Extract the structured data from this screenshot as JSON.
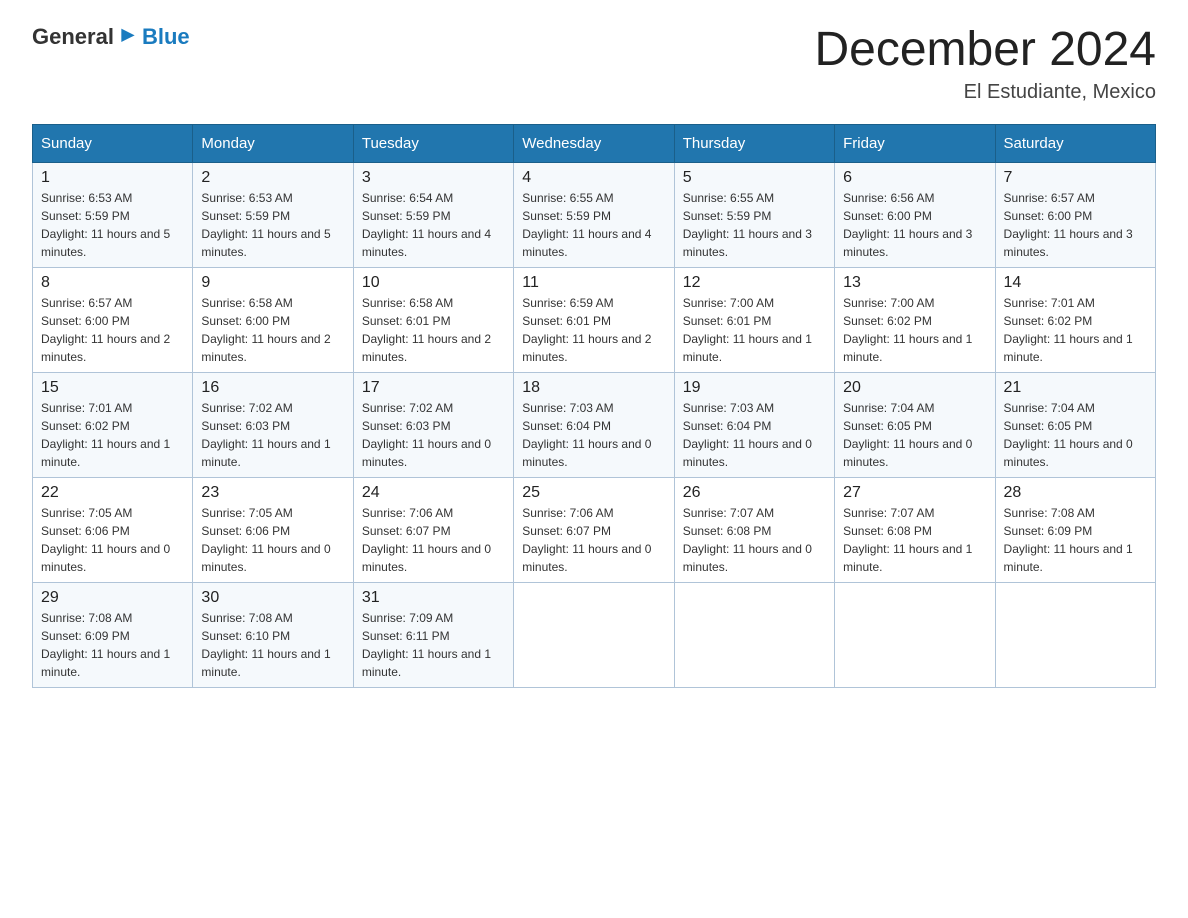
{
  "header": {
    "logo_general": "General",
    "logo_blue": "Blue",
    "month_title": "December 2024",
    "location": "El Estudiante, Mexico"
  },
  "weekdays": [
    "Sunday",
    "Monday",
    "Tuesday",
    "Wednesday",
    "Thursday",
    "Friday",
    "Saturday"
  ],
  "weeks": [
    [
      {
        "day": "1",
        "sunrise": "6:53 AM",
        "sunset": "5:59 PM",
        "daylight": "11 hours and 5 minutes."
      },
      {
        "day": "2",
        "sunrise": "6:53 AM",
        "sunset": "5:59 PM",
        "daylight": "11 hours and 5 minutes."
      },
      {
        "day": "3",
        "sunrise": "6:54 AM",
        "sunset": "5:59 PM",
        "daylight": "11 hours and 4 minutes."
      },
      {
        "day": "4",
        "sunrise": "6:55 AM",
        "sunset": "5:59 PM",
        "daylight": "11 hours and 4 minutes."
      },
      {
        "day": "5",
        "sunrise": "6:55 AM",
        "sunset": "5:59 PM",
        "daylight": "11 hours and 3 minutes."
      },
      {
        "day": "6",
        "sunrise": "6:56 AM",
        "sunset": "6:00 PM",
        "daylight": "11 hours and 3 minutes."
      },
      {
        "day": "7",
        "sunrise": "6:57 AM",
        "sunset": "6:00 PM",
        "daylight": "11 hours and 3 minutes."
      }
    ],
    [
      {
        "day": "8",
        "sunrise": "6:57 AM",
        "sunset": "6:00 PM",
        "daylight": "11 hours and 2 minutes."
      },
      {
        "day": "9",
        "sunrise": "6:58 AM",
        "sunset": "6:00 PM",
        "daylight": "11 hours and 2 minutes."
      },
      {
        "day": "10",
        "sunrise": "6:58 AM",
        "sunset": "6:01 PM",
        "daylight": "11 hours and 2 minutes."
      },
      {
        "day": "11",
        "sunrise": "6:59 AM",
        "sunset": "6:01 PM",
        "daylight": "11 hours and 2 minutes."
      },
      {
        "day": "12",
        "sunrise": "7:00 AM",
        "sunset": "6:01 PM",
        "daylight": "11 hours and 1 minute."
      },
      {
        "day": "13",
        "sunrise": "7:00 AM",
        "sunset": "6:02 PM",
        "daylight": "11 hours and 1 minute."
      },
      {
        "day": "14",
        "sunrise": "7:01 AM",
        "sunset": "6:02 PM",
        "daylight": "11 hours and 1 minute."
      }
    ],
    [
      {
        "day": "15",
        "sunrise": "7:01 AM",
        "sunset": "6:02 PM",
        "daylight": "11 hours and 1 minute."
      },
      {
        "day": "16",
        "sunrise": "7:02 AM",
        "sunset": "6:03 PM",
        "daylight": "11 hours and 1 minute."
      },
      {
        "day": "17",
        "sunrise": "7:02 AM",
        "sunset": "6:03 PM",
        "daylight": "11 hours and 0 minutes."
      },
      {
        "day": "18",
        "sunrise": "7:03 AM",
        "sunset": "6:04 PM",
        "daylight": "11 hours and 0 minutes."
      },
      {
        "day": "19",
        "sunrise": "7:03 AM",
        "sunset": "6:04 PM",
        "daylight": "11 hours and 0 minutes."
      },
      {
        "day": "20",
        "sunrise": "7:04 AM",
        "sunset": "6:05 PM",
        "daylight": "11 hours and 0 minutes."
      },
      {
        "day": "21",
        "sunrise": "7:04 AM",
        "sunset": "6:05 PM",
        "daylight": "11 hours and 0 minutes."
      }
    ],
    [
      {
        "day": "22",
        "sunrise": "7:05 AM",
        "sunset": "6:06 PM",
        "daylight": "11 hours and 0 minutes."
      },
      {
        "day": "23",
        "sunrise": "7:05 AM",
        "sunset": "6:06 PM",
        "daylight": "11 hours and 0 minutes."
      },
      {
        "day": "24",
        "sunrise": "7:06 AM",
        "sunset": "6:07 PM",
        "daylight": "11 hours and 0 minutes."
      },
      {
        "day": "25",
        "sunrise": "7:06 AM",
        "sunset": "6:07 PM",
        "daylight": "11 hours and 0 minutes."
      },
      {
        "day": "26",
        "sunrise": "7:07 AM",
        "sunset": "6:08 PM",
        "daylight": "11 hours and 0 minutes."
      },
      {
        "day": "27",
        "sunrise": "7:07 AM",
        "sunset": "6:08 PM",
        "daylight": "11 hours and 1 minute."
      },
      {
        "day": "28",
        "sunrise": "7:08 AM",
        "sunset": "6:09 PM",
        "daylight": "11 hours and 1 minute."
      }
    ],
    [
      {
        "day": "29",
        "sunrise": "7:08 AM",
        "sunset": "6:09 PM",
        "daylight": "11 hours and 1 minute."
      },
      {
        "day": "30",
        "sunrise": "7:08 AM",
        "sunset": "6:10 PM",
        "daylight": "11 hours and 1 minute."
      },
      {
        "day": "31",
        "sunrise": "7:09 AM",
        "sunset": "6:11 PM",
        "daylight": "11 hours and 1 minute."
      },
      null,
      null,
      null,
      null
    ]
  ]
}
